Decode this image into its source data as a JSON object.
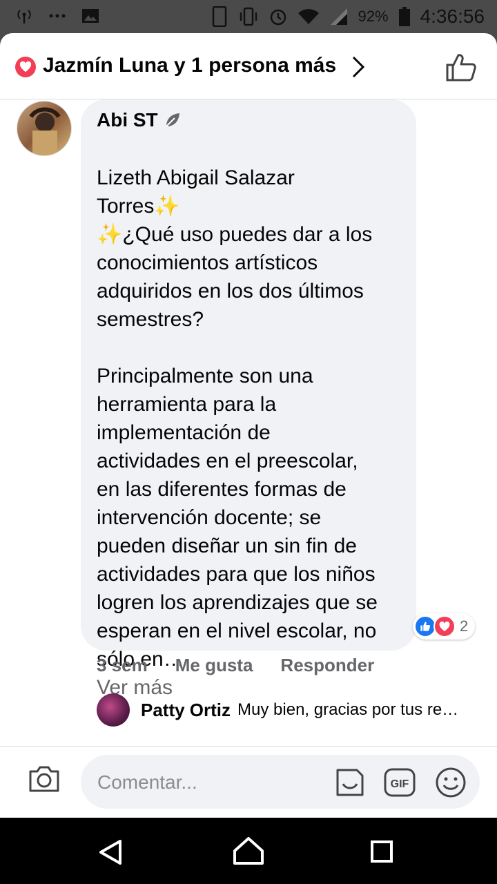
{
  "status_bar": {
    "battery": "92%",
    "time": "4:36:56",
    "icons": [
      "antenna-icon",
      "more-icon",
      "image-icon",
      "phone-icon",
      "vibrate-icon",
      "alarm-icon",
      "wifi-icon",
      "signal-icon",
      "battery-icon"
    ]
  },
  "header": {
    "reactors": "Jazmín Luna y 1 persona más",
    "reaction_icon": "heart-icon",
    "like_icon": "like-outline-icon"
  },
  "comment": {
    "author": "Abi ST",
    "badge_icon": "leaf-badge-icon",
    "body": "Lizeth Abigail Salazar\nTorres✨\n✨¿Qué uso puedes dar a los\nconocimientos artísticos\nadquiridos en los dos últimos\nsemestres?\n\nPrincipalmente son una\nherramienta para la\nimplementación de\nactividades en el preescolar,\nen las diferentes formas de\nintervención docente; se\npueden diseñar un sin fin de\nactividades para que los niños\nlogren los aprendizajes que se\nesperan en el nivel escolar, no\nsólo en…",
    "see_more": "Ver más",
    "reaction_count": "2",
    "time": "3 sem",
    "like_label": "Me gusta",
    "reply_label": "Responder"
  },
  "reply": {
    "name": "Patty Ortiz",
    "text": "Muy bien, gracias por tus re…"
  },
  "composer": {
    "placeholder": "Comentar..."
  },
  "colors": {
    "facebook_blue": "#1877f2",
    "love_red": "#f33e58",
    "bubble": "#f0f2f5",
    "secondary_text": "#65676b"
  }
}
